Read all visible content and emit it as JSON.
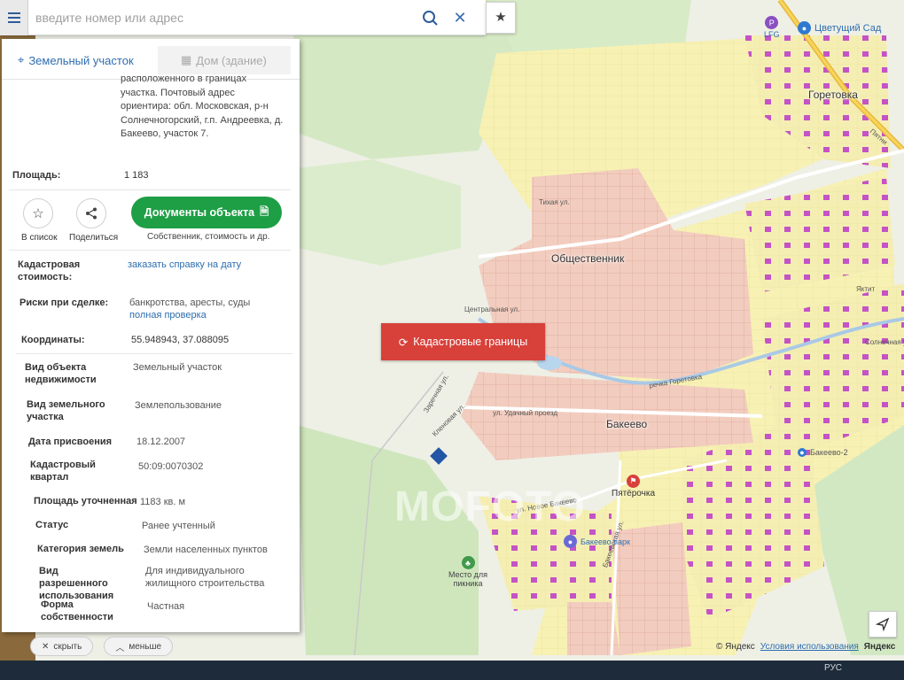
{
  "search": {
    "placeholder": "введите номер или адрес"
  },
  "tabs": {
    "land": "Земельный участок",
    "house": "Дом (здание)"
  },
  "address_text": "расположенного в границах участка. Почтовый адрес ориентира: обл. Московская, р-н Солнечногорский, г.п. Андреевка, д. Бакеево, участок 7.",
  "area": {
    "label": "Площадь:",
    "value": "1 183"
  },
  "actions": {
    "favorite": "В список",
    "share": "Поделиться",
    "docs_button": "Документы объекта",
    "docs_sub": "Собственник, стоимость и др."
  },
  "details": {
    "cadastral_cost": {
      "label": "Кадастровая стоимость:",
      "link": "заказать справку на дату"
    },
    "risks": {
      "label": "Риски при сделке:",
      "value": "банкротства, аресты, суды",
      "link": "полная проверка"
    },
    "coords": {
      "label": "Координаты:",
      "value": "55.948943, 37.088095"
    },
    "rows": [
      {
        "label": "Вид объекта недвижимости",
        "value": "Земельный участок"
      },
      {
        "label": "Вид земельного участка",
        "value": "Землепользование"
      },
      {
        "label": "Дата присвоения",
        "value": "18.12.2007"
      },
      {
        "label": "Кадастровый квартал",
        "value": "50:09:0070302"
      },
      {
        "label": "Площадь уточненная",
        "value": "1183 кв. м"
      },
      {
        "label": "Статус",
        "value": "Ранее учтенный"
      },
      {
        "label": "Категория земель",
        "value": "Земли населенных пунктов"
      },
      {
        "label": "Вид разрешенного использования",
        "value": "Для индивидуального жилищного строительства"
      },
      {
        "label": "Форма собственности",
        "value": "Частная"
      }
    ]
  },
  "bottom": {
    "hide": "скрыть",
    "less": "меньше"
  },
  "map": {
    "cadastral_button": "Кадастровые границы",
    "places": {
      "gosetovka": "Горетовка",
      "obshch": "Общественник",
      "bakeevo": "Бакеево"
    },
    "poi": {
      "lfg": "LFG",
      "garden": "Цветущий Сад",
      "pyaterochka": "Пятёрочка",
      "picnic": "Место для пикника",
      "bakeevo_park": "Бакеево парк",
      "bakeevo2": "Бакеево-2"
    },
    "streets": {
      "tikhaya": "Тихая ул.",
      "tsentr": "Центральная ул.",
      "rechka": "речка Горетовка",
      "udachnyi": "ул. Удачный проезд",
      "zarechnaya": "Заречная ул.",
      "klenovaya": "Кленовая ул.",
      "novo": "ул. Новое Бакеево",
      "bakeevo_street": "Бакеевская ул.",
      "solnech": "Солнечная ул.",
      "yakt": "Яктит",
      "lesnaya": "Лесная ул.",
      "pyatnitsk": "Пятни"
    },
    "copyright": "© Яндекс",
    "terms": "Условия использования",
    "brand": "Яндекс"
  },
  "watermark": "MOFOTO",
  "taskbar": {
    "lang": "РУС"
  },
  "colors": {
    "accent": "#2e6db1",
    "green": "#1e9e45",
    "red": "#d8403a"
  }
}
